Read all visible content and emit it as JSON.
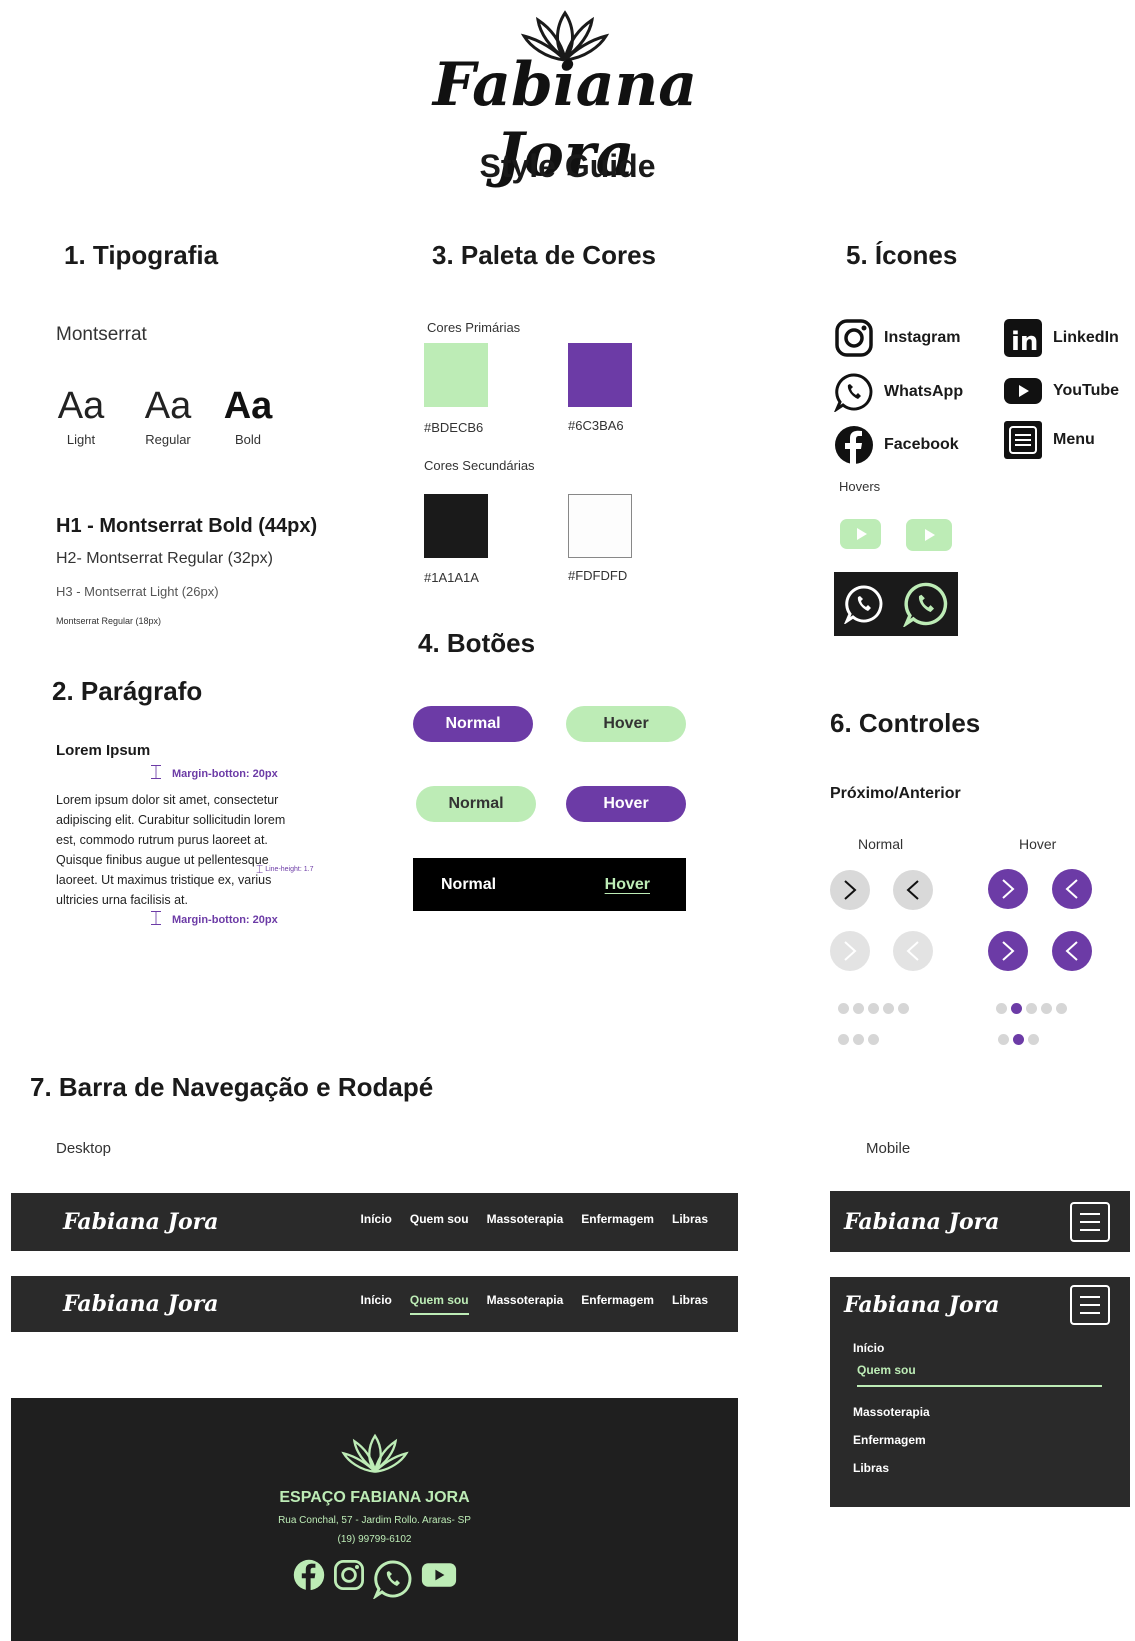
{
  "header": {
    "logo": "Fabiana Jora",
    "title": "Style Guide"
  },
  "typography": {
    "heading": "1. Tipografia",
    "font_name": "Montserrat",
    "samples": [
      {
        "glyph": "Aa",
        "label": "Light"
      },
      {
        "glyph": "Aa",
        "label": "Regular"
      },
      {
        "glyph": "Aa",
        "label": "Bold"
      }
    ],
    "h1": "H1 - Montserrat Bold (44px)",
    "h2": "H2- Montserrat Regular (32px)",
    "h3": "H3 - Montserrat Light (26px)",
    "body": "Montserrat Regular (18px)"
  },
  "paragraph": {
    "heading": "2. Parágrafo",
    "title": "Lorem Ipsum",
    "margin_top": "Margin-botton: 20px",
    "lines": [
      "Lorem ipsum dolor sit amet, consectetur",
      "adipiscing elit. Curabitur sollicitudin lorem",
      "est, commodo rutrum purus laoreet at.",
      "Quisque finibus augue ut pellentesque",
      "laoreet. Ut maximus tristique ex, varius",
      "ultricies urna facilisis at."
    ],
    "line_height": "Line-height: 1.7",
    "margin_bottom": "Margin-botton: 20px"
  },
  "palette": {
    "heading": "3. Paleta de Cores",
    "primary_label": "Cores Primárias",
    "secondary_label": "Cores Secundárias",
    "primary": [
      {
        "hex": "#BDECB6",
        "label": "#BDECB6"
      },
      {
        "hex": "#6C3BA6",
        "label": "#6C3BA6"
      }
    ],
    "secondary": [
      {
        "hex": "#1A1A1A",
        "label": "#1A1A1A"
      },
      {
        "hex": "#FDFDFD",
        "label": "#FDFDFD"
      }
    ]
  },
  "buttons": {
    "heading": "4. Botões",
    "normal": "Normal",
    "hover": "Hover"
  },
  "icons": {
    "heading": "5. Ícones",
    "items": [
      "Instagram",
      "LinkedIn",
      "WhatsApp",
      "YouTube",
      "Facebook",
      "Menu"
    ],
    "hovers_label": "Hovers"
  },
  "controls": {
    "heading": "6. Controles",
    "subheading": "Próximo/Anterior",
    "normal": "Normal",
    "hover": "Hover",
    "dots_row1_active": 2,
    "dots_row2_active": 2
  },
  "navigation": {
    "heading": "7. Barra de Navegação e Rodapé",
    "desktop_label": "Desktop",
    "mobile_label": "Mobile",
    "links": [
      "Início",
      "Quem sou",
      "Massoterapia",
      "Enfermagem",
      "Libras"
    ],
    "logo": "Fabiana Jora"
  },
  "footer": {
    "name": "ESPAÇO FABIANA JORA",
    "address": "Rua Conchal, 57 - Jardim Rollo. Araras- SP",
    "phone": "(19) 99799-6102"
  },
  "colors": {
    "primary_green": "#BDECB6",
    "primary_purple": "#6C3BA6",
    "dark": "#1A1A1A",
    "light": "#FDFDFD"
  }
}
